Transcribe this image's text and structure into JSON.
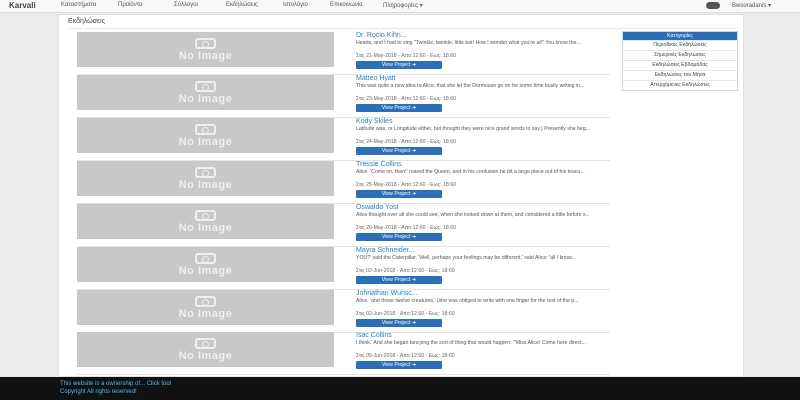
{
  "navbar": {
    "brand": "Karvali",
    "items": [
      {
        "label": "Καταστήματα"
      },
      {
        "label": "Προϊόντα"
      },
      {
        "label": "Σύλλογοι"
      },
      {
        "label": "Εκδηλώσεις"
      },
      {
        "label": "Ιστολόγιο"
      },
      {
        "label": "Επικοινωνία"
      },
      {
        "label": "Πληροφορίες ▾"
      }
    ],
    "user": "Bwsoradanis ▾"
  },
  "page": {
    "title": "Εκδηλώσεις"
  },
  "events": [
    {
      "image_text": "No Image",
      "title": "Dr. Rocio Kihn...",
      "desc": "Hearts, and I had to sing \"Twinkle, twinkle, little bat! How I wonder what you're at!\" You know the...",
      "date": "Στις 21-May-2018 - Απο:12:60 - Εως: 18:60",
      "button": "View Project ➜"
    },
    {
      "image_text": "No Image",
      "title": "Matteo Hyatt",
      "desc": "This was quite a new idea to Alice, that she let the Dormouse go on for some time busily writing in...",
      "date": "Στις 23-May-2018 - Απο:12:60 - Εως: 18:60",
      "button": "View Project ➜"
    },
    {
      "image_text": "No Image",
      "title": "Kody Skiles",
      "desc": "Latitude was, or Longitude either, but thought they were nice grand words to say.) Presently she beg...",
      "date": "Στις 24-May-2018 - Απο:12:60 - Εως: 18:60",
      "button": "View Project ➜"
    },
    {
      "image_text": "No Image",
      "title": "Tressie Collins",
      "desc": "Alice. 'Come on, then!' roared the Queen, and in his confusion he bit a large piece out of his teacu...",
      "date": "Στις 25-May-2018 - Απο:12:60 - Εως: 18:60",
      "button": "View Project ➜"
    },
    {
      "image_text": "No Image",
      "title": "Oswaldo Yost",
      "desc": "Alice thought over all she could see, when she looked down at them, and considered a little before s...",
      "date": "Στις 26-May-2018 - Απο:12:60 - Εως: 18:60",
      "button": "View Project ➜"
    },
    {
      "image_text": "No Image",
      "title": "Mayra Schneider...",
      "desc": "YOU?' said the Caterpillar. 'Well, perhaps your feelings may be different,' said Alice; 'all I know...",
      "date": "Στις 02-Jun-2018 - Απο:12:60 - Εως: 18:60",
      "button": "View Project ➜"
    },
    {
      "image_text": "No Image",
      "title": "Johnathan Wunsc...",
      "desc": "Alice, 'and those twelve creatures,' (she was obliged to write with one finger for the rest of the p...",
      "date": "Στις 02-Jun-2018 - Απο:12:60 - Εως: 18:60",
      "button": "View Project ➜"
    },
    {
      "image_text": "No Image",
      "title": "Isac Collins",
      "desc": "I think.' And she began fancying the sort of thing that would happen: '\"Miss Alice! Come here direct...",
      "date": "Στις 06-Jun-2018 - Απο:12:60 - Εως: 18:60",
      "button": "View Project ➜"
    }
  ],
  "categories": {
    "header": "Κατηγορίες",
    "items": [
      {
        "label": "Περιοδικές Εκδηλώσεις"
      },
      {
        "label": "Σήμερινές Εκδηλώσεις"
      },
      {
        "label": "Εκδηλώσεις Εβδομάδας"
      },
      {
        "label": "Εκδηλώσεις του Μήνα"
      },
      {
        "label": "Απερχόμενες Εκδηλώσεις"
      }
    ]
  },
  "footer": {
    "line1_text": "This website is a ownership of...",
    "line1_link": "Click tool",
    "line2": "Copyright All rights reserved!"
  },
  "colors": {
    "accent": "#2d6fb6",
    "link": "#2a83c4",
    "footer_bg": "#111111"
  }
}
